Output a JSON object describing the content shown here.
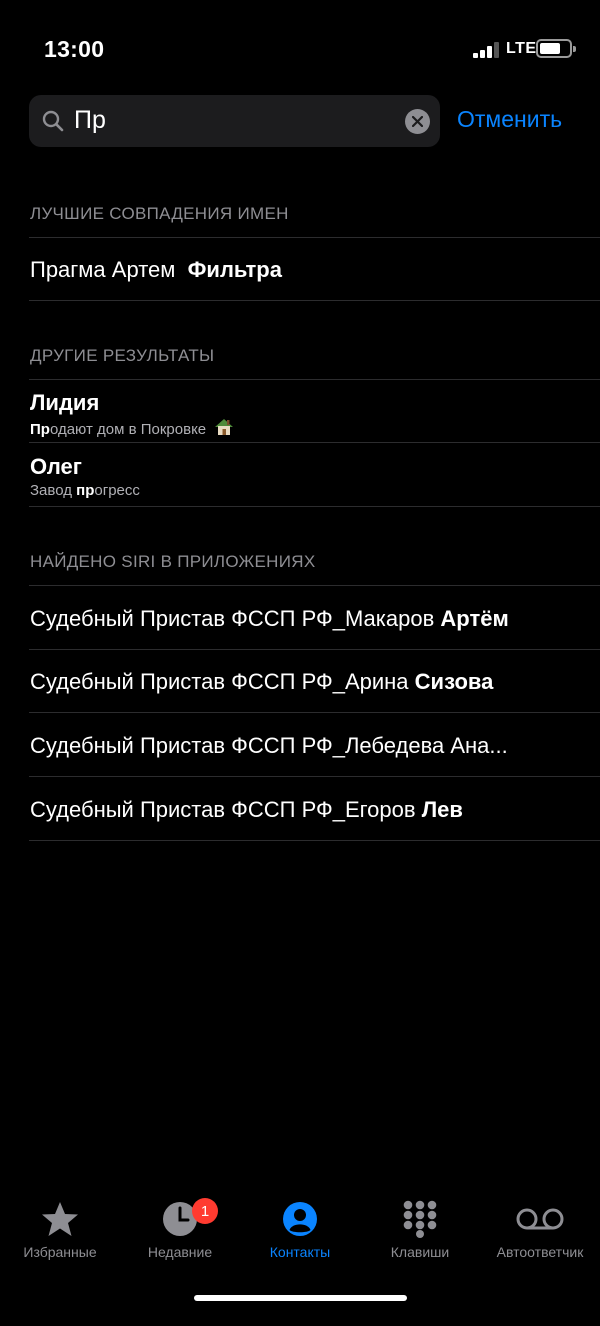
{
  "status_bar": {
    "time": "13:00",
    "network": "LTE"
  },
  "search": {
    "query": "Пр",
    "cancel_label": "Отменить"
  },
  "sections": {
    "best_matches": {
      "title": "ЛУЧШИЕ СОВПАДЕНИЯ ИМЕН",
      "items": [
        {
          "first": "Прагма Артем",
          "last": "Фильтра"
        }
      ]
    },
    "other_results": {
      "title": "ДРУГИЕ РЕЗУЛЬТАТЫ",
      "items": [
        {
          "name": "Лидия",
          "sub_match": "Пр",
          "sub_rest": "одают дом в Покровке"
        },
        {
          "name": "Олег",
          "sub_before": "Завод ",
          "sub_match": "пр",
          "sub_rest": "огресс"
        }
      ]
    },
    "siri_found": {
      "title": "НАЙДЕНО SIRI В ПРИЛОЖЕНИЯХ",
      "items": [
        {
          "first": "Судебный Пристав ФССП РФ_Макаров",
          "last": "Артём"
        },
        {
          "first": "Судебный Пристав ФССП РФ_Арина",
          "last": "Сизова"
        },
        {
          "first": "Судебный Пристав ФССП РФ_Лебедева Ана...",
          "last": ""
        },
        {
          "first": "Судебный Пристав ФССП РФ_Егоров",
          "last": "Лев"
        }
      ]
    }
  },
  "tab_bar": {
    "tabs": [
      {
        "label": "Избранные",
        "icon": "star-icon"
      },
      {
        "label": "Недавние",
        "icon": "clock-icon",
        "badge": "1"
      },
      {
        "label": "Контакты",
        "icon": "person-circle-icon",
        "active": true
      },
      {
        "label": "Клавиши",
        "icon": "keypad-icon"
      },
      {
        "label": "Автоответчик",
        "icon": "voicemail-icon"
      }
    ]
  },
  "colors": {
    "accent": "#0a84ff",
    "badge": "#ff3b30",
    "background": "#000000",
    "field": "#1c1c1e",
    "secondary_text": "#8e8e93"
  }
}
